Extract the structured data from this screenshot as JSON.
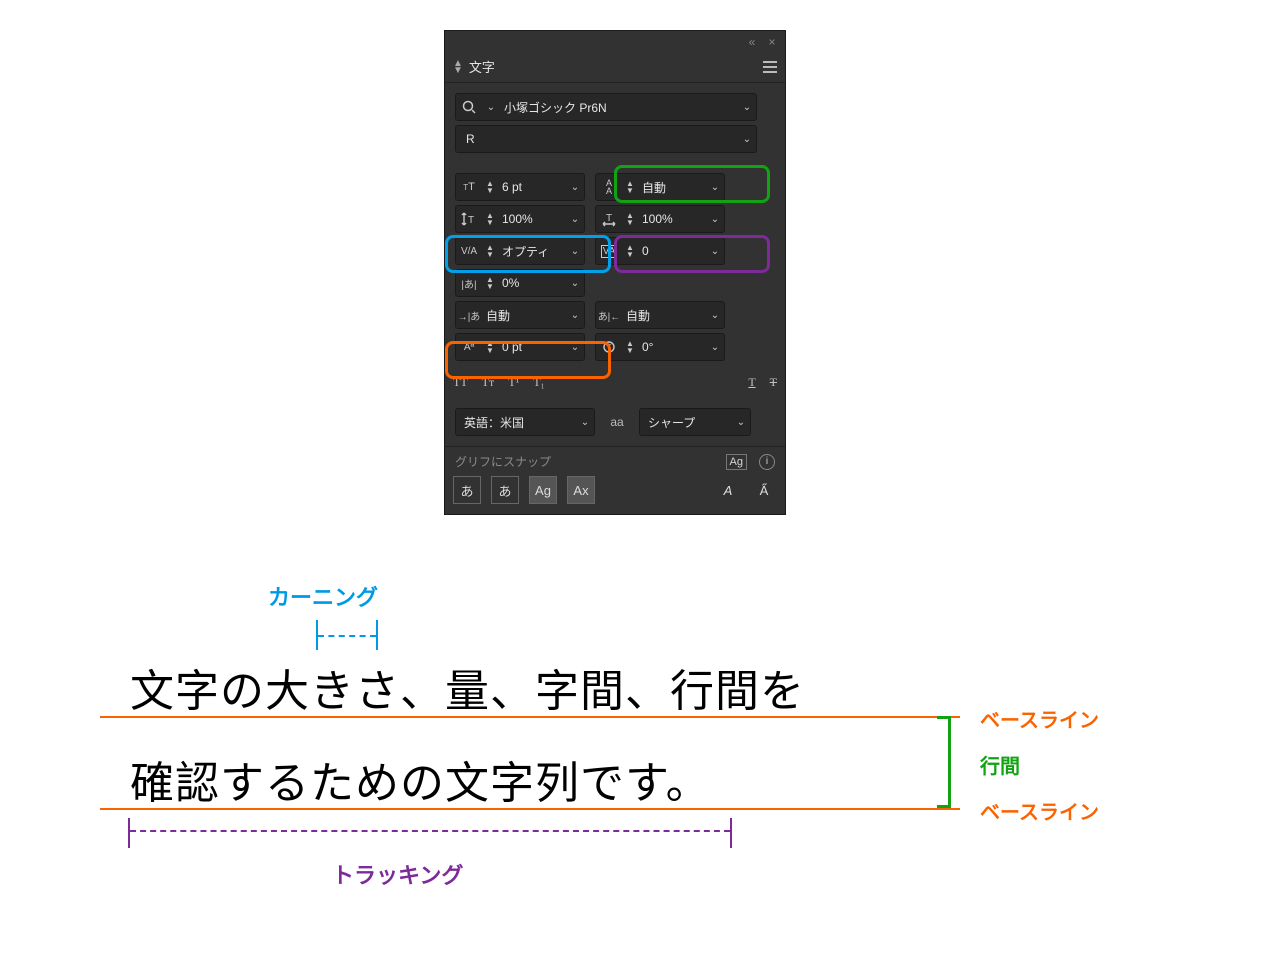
{
  "panel": {
    "title": "文字",
    "font_family": "小塚ゴシック Pr6N",
    "font_style": "R",
    "size": "6 pt",
    "leading": "自動",
    "vscale": "100%",
    "hscale": "100%",
    "kerning": "オプティ",
    "tracking": "0",
    "tsume": "0%",
    "aki_left": "自動",
    "aki_right": "自動",
    "baseline_shift": "0 pt",
    "rotation": "0°",
    "language": "英語：米国",
    "antialias": "シャープ",
    "snap_label": "グリフにスナップ",
    "case_allcaps": "TT",
    "case_smallcaps": "Tᴛ",
    "superscript": "T¹",
    "subscript": "T₁",
    "underline": "T",
    "strike": "T",
    "antialias_icon": "aa"
  },
  "colors": {
    "kerning_hl": "#00a0ea",
    "tracking_hl": "#7d2a9a",
    "leading_hl": "#12a312",
    "baseline_hl": "#f96300"
  },
  "sample": {
    "line1": "文字の大きさ、量、字間、行間を",
    "line2": "確認するための文字列です。",
    "kerning_label": "カーニング",
    "tracking_label": "トラッキング",
    "leading_label": "行間",
    "baseline_label": "ベースライン"
  }
}
